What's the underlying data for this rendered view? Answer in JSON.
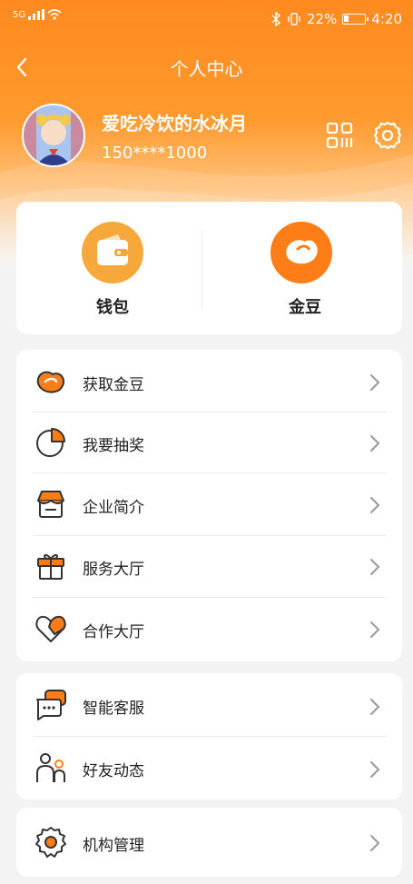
{
  "status_bar": {
    "network": "5G",
    "battery_percent": "22%",
    "time": "4:20"
  },
  "nav": {
    "title": "个人中心"
  },
  "profile": {
    "name": "爱吃冷饮的水冰月",
    "phone": "150****1000"
  },
  "assets": [
    {
      "label": "钱包",
      "icon": "wallet-icon",
      "color": "#f6a83a"
    },
    {
      "label": "金豆",
      "icon": "bean-icon",
      "color": "#ff7d17"
    }
  ],
  "menu_group_1": [
    {
      "label": "获取金豆",
      "icon": "bean-icon"
    },
    {
      "label": "我要抽奖",
      "icon": "pie-lottery-icon"
    },
    {
      "label": "企业简介",
      "icon": "shop-icon"
    },
    {
      "label": "服务大厅",
      "icon": "gift-icon"
    },
    {
      "label": "合作大厅",
      "icon": "handshake-heart-icon"
    }
  ],
  "menu_group_2": [
    {
      "label": "智能客服",
      "icon": "chat-icon"
    },
    {
      "label": "好友动态",
      "icon": "friends-icon"
    }
  ],
  "menu_group_3": [
    {
      "label": "机构管理",
      "icon": "gear-icon"
    }
  ],
  "colors": {
    "accent": "#ff8a1f",
    "icon_orange": "#ff7d17",
    "icon_outline": "#333333"
  }
}
